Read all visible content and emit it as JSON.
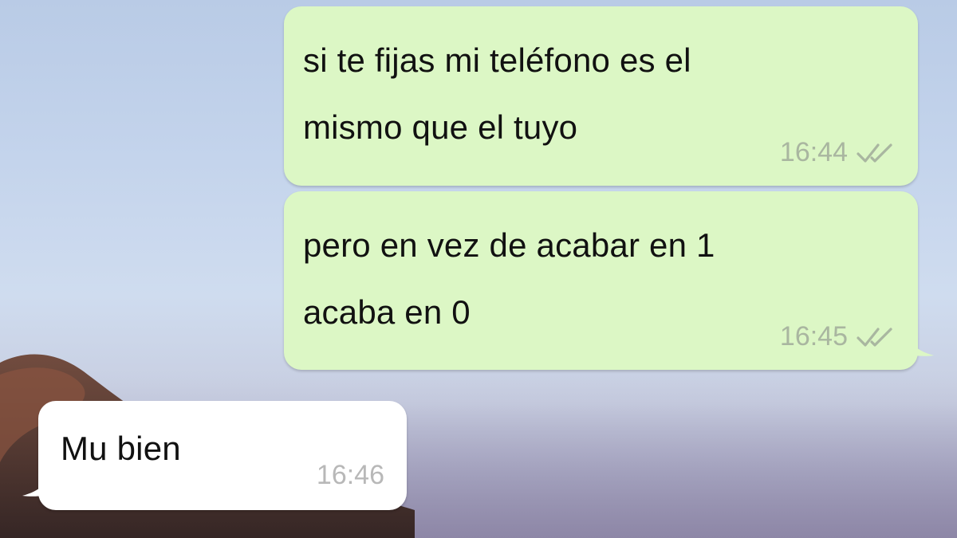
{
  "chat": {
    "messages": [
      {
        "direction": "outgoing",
        "text": "si te fijas mi teléfono es el\nmismo que el tuyo",
        "time": "16:44",
        "status_icon": "double-check-icon"
      },
      {
        "direction": "outgoing",
        "text": "pero en vez de acabar en 1\nacaba en 0",
        "time": "16:45",
        "status_icon": "double-check-icon"
      },
      {
        "direction": "incoming",
        "text": "Mu bien",
        "time": "16:46"
      }
    ]
  },
  "colors": {
    "outgoing_bubble": "#dcf7c5",
    "incoming_bubble": "#ffffff",
    "timestamp": "#a9b6a0",
    "check": "#a9b6a0"
  }
}
